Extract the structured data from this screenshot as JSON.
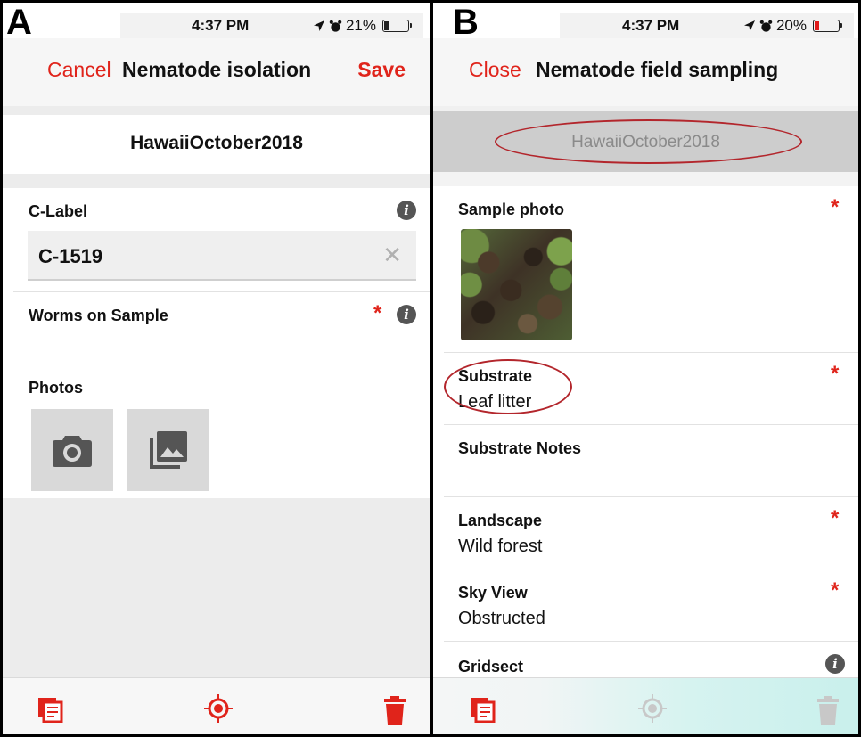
{
  "panel_a": {
    "letter": "A",
    "status": {
      "time": "4:37 PM",
      "battery": "21%",
      "battery_level": 0.21
    },
    "nav": {
      "left": "Cancel",
      "title": "Nematode isolation",
      "right": "Save"
    },
    "project": "HawaiiOctober2018",
    "clabel": {
      "label": "C-Label",
      "value": "C-1519"
    },
    "worms": {
      "label": "Worms on Sample",
      "required": "*"
    },
    "photos": {
      "label": "Photos"
    }
  },
  "panel_b": {
    "letter": "B",
    "status": {
      "time": "4:37 PM",
      "battery": "20%",
      "battery_level": 0.2
    },
    "nav": {
      "left": "Close",
      "title": "Nematode field sampling"
    },
    "project": "HawaiiOctober2018",
    "sample_photo": {
      "label": "Sample photo",
      "required": "*"
    },
    "substrate": {
      "label": "Substrate",
      "value": "Leaf litter",
      "required": "*"
    },
    "substrate_notes": {
      "label": "Substrate Notes"
    },
    "landscape": {
      "label": "Landscape",
      "value": "Wild forest",
      "required": "*"
    },
    "sky_view": {
      "label": "Sky View",
      "value": "Obstructed",
      "required": "*"
    },
    "gridsect": {
      "label": "Gridsect"
    }
  },
  "colors": {
    "accent_red": "#e0241b",
    "circle_red": "#b3262c",
    "divider": "#000000"
  }
}
